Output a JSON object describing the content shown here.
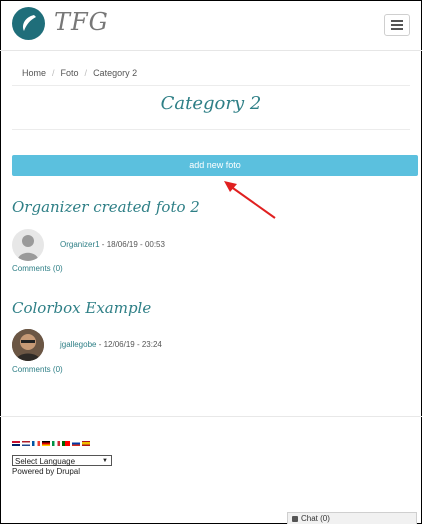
{
  "header": {
    "site_name": "TFG",
    "logo_icon": "tfg-logo-icon",
    "menu_icon": "hamburger-menu-icon"
  },
  "breadcrumb": {
    "items": [
      "Home",
      "Foto",
      "Category 2"
    ],
    "separator": "/"
  },
  "page": {
    "title": "Category 2",
    "add_button_label": "add new foto"
  },
  "posts": [
    {
      "title": "Organizer created foto 2",
      "author": "Organizer1",
      "meta_suffix": " - 18/06/19 - 00:53",
      "comments": "Comments (0)"
    },
    {
      "title": "Colorbox Example",
      "author": "jgallegobe",
      "meta_suffix": " - 12/06/19 - 23:24",
      "comments": "Comments (0)"
    }
  ],
  "footer": {
    "language_select_value": "Select Language",
    "powered_by": "Powered by Drupal"
  },
  "chat": {
    "label": "Chat (0)"
  },
  "colors": {
    "accent": "#2e7f86",
    "button": "#5bc0de",
    "arrow": "#e02020"
  }
}
